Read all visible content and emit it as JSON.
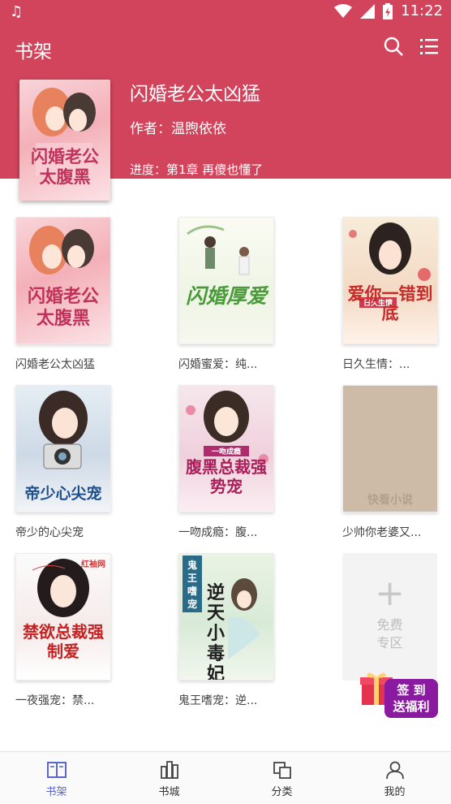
{
  "status_bar": {
    "time": "11:22"
  },
  "header": {
    "title": "书架"
  },
  "hero": {
    "title": "闪婚老公太凶猛",
    "author": "作者：温煦依依",
    "progress": "进度：第1章 再傻也懂了",
    "cover_text": "闪婚老公太腹黑"
  },
  "books": [
    {
      "name": "闪婚老公太凶猛",
      "cover_text": "闪婚老公太腹黑"
    },
    {
      "name": "闪婚蜜爱：纯...",
      "cover_text": "闪婚厚爱"
    },
    {
      "name": "日久生情：...",
      "cover_text": "爱你一错到底",
      "cover_sub": "日久生情"
    },
    {
      "name": "帝少的心尖宠",
      "cover_text": "帝少心尖宠"
    },
    {
      "name": "一吻成瘾：腹...",
      "cover_text": "腹黑总裁强势宠",
      "cover_sub": "一吻成瘾"
    },
    {
      "name": "少帅你老婆又...",
      "cover_text": "快看小说"
    },
    {
      "name": "一夜强宠：禁...",
      "cover_text": "禁欲总裁强制爱",
      "cover_sub": "红袖网"
    },
    {
      "name": "鬼王嗜宠：逆...",
      "cover_text": "逆天小毒妃",
      "cover_sub": "鬼王嗜宠"
    }
  ],
  "free_zone": {
    "line1": "免费",
    "line2": "专区"
  },
  "gift_banner": {
    "line1": "签 到",
    "line2": "送福利"
  },
  "bottom_nav": [
    {
      "label": "书架",
      "active": true
    },
    {
      "label": "书城",
      "active": false
    },
    {
      "label": "分类",
      "active": false
    },
    {
      "label": "我的",
      "active": false
    }
  ],
  "colors": {
    "primary": "#d2445c",
    "nav_active": "#5b68c9",
    "gift": "#8a1ba0"
  }
}
